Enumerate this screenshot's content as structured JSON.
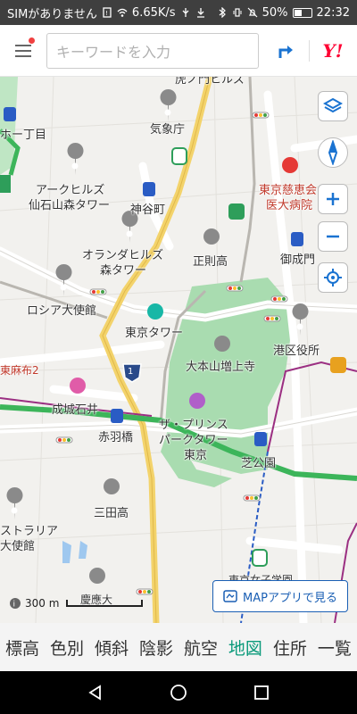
{
  "statusbar": {
    "carrier": "SIMがありません",
    "speed": "6.65K/s",
    "battery_pct": "50%",
    "battery_level": 0.5,
    "time": "22:32"
  },
  "topbar": {
    "search_placeholder": "キーワードを入力",
    "brand": "Y!"
  },
  "map": {
    "labels": {
      "toranomon": "虎ノ門ヒルズ",
      "nishishinbashi": "ホー丁目",
      "kishocho": "気象庁",
      "ark_hills": "アークヒルズ",
      "sengokuyama": "仙石山森タワー",
      "kamiyacho": "神谷町",
      "jikei": "東京慈恵会",
      "jikei2": "医大病院",
      "oranda": "オランダヒルズ",
      "mori_tower": "森タワー",
      "seisoku": "正則高",
      "onarimon": "御成門",
      "russia": "ロシア大使館",
      "tokyo_tower": "東京タワー",
      "minato_office": "港区役所",
      "azabu": "東麻布2",
      "zojoji": "大本山増上寺",
      "seijo": "成城石井",
      "akabanebashi": "赤羽橋",
      "prince1": "ザ・プリンス",
      "prince2": "パークタワー",
      "prince3": "東京",
      "shibakoen": "芝公園",
      "mita_high": "三田高",
      "australia1": "ストラリア",
      "australia2": "大使館",
      "tokyo_joshi": "東京女子学園",
      "keio": "慶應大",
      "route_1": "1"
    },
    "scale_label": "300 m",
    "mapapp_button": "MAPアプリで見る"
  },
  "tabs": [
    {
      "label": "標高"
    },
    {
      "label": "色別"
    },
    {
      "label": "傾斜"
    },
    {
      "label": "陰影"
    },
    {
      "label": "航空"
    },
    {
      "label": "地図",
      "active": true
    },
    {
      "label": "住所"
    },
    {
      "label": "一覧"
    }
  ],
  "colors": {
    "accent": "#1a73d1",
    "active_tab": "#0a9a7a",
    "park": "#a9dcb0",
    "highway": "#f3d36b",
    "rail_green": "#3cb55a",
    "rail_purple": "#9b2f82"
  }
}
